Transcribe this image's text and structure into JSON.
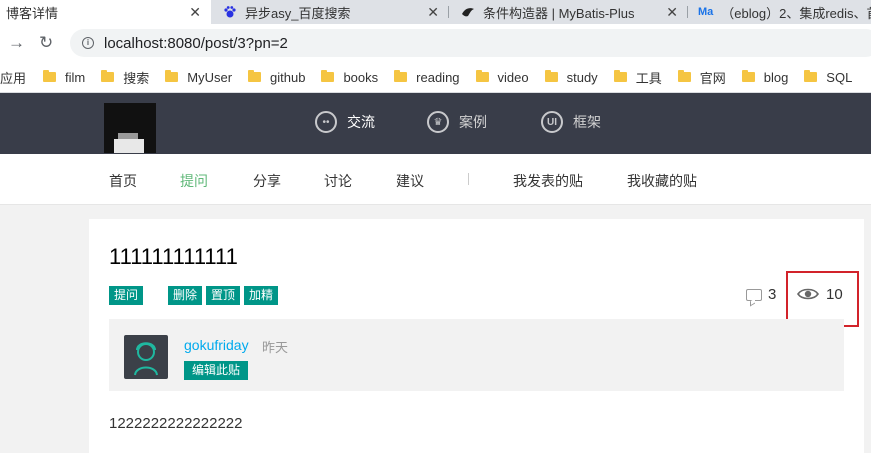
{
  "browser": {
    "tabs": [
      {
        "title": "博客详情",
        "active": true
      },
      {
        "title": "异步asy_百度搜索",
        "active": false
      },
      {
        "title": "条件构造器 | MyBatis-Plus",
        "active": false
      },
      {
        "title": "（eblog）2、集成redis、首",
        "active": false
      }
    ],
    "url": "localhost:8080/post/3?pn=2",
    "bookmarks": [
      "应用",
      "film",
      "搜索",
      "MyUser",
      "github",
      "books",
      "reading",
      "video",
      "study",
      "工具",
      "官网",
      "blog",
      "SQL"
    ]
  },
  "header": {
    "nav": [
      {
        "label": "交流",
        "icon": "chat-icon"
      },
      {
        "label": "案例",
        "icon": "crown-icon"
      },
      {
        "label": "框架",
        "icon": "ui-icon"
      }
    ]
  },
  "subnav": {
    "items": [
      "首页",
      "提问",
      "分享",
      "讨论",
      "建议"
    ],
    "current": "提问",
    "user_items": [
      "我发表的贴",
      "我收藏的贴"
    ]
  },
  "post": {
    "title": "111111111111",
    "category": "提问",
    "actions": [
      "删除",
      "置顶",
      "加精"
    ],
    "comment_count": "3",
    "view_count": "10",
    "author": "gokufriday",
    "time": "昨天",
    "edit_label": "编辑此贴",
    "content": "1222222222222222"
  },
  "colors": {
    "accent": "#009688",
    "header_bg": "#393d49",
    "current_nav": "#5fb878",
    "author_link": "#01aaed",
    "highlight": "#d2232a"
  }
}
